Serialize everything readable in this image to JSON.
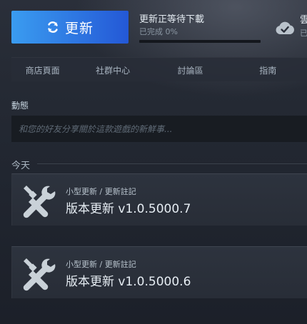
{
  "top": {
    "update_button_label": "更新",
    "download_status_title": "更新正等待下載",
    "download_status_sub": "已完成 0%",
    "download_progress_percent": 0,
    "cloud_label": "雲",
    "cloud_sub": "已",
    "update_button_color": "#2f7ee6"
  },
  "tabs": [
    {
      "label": "商店頁面"
    },
    {
      "label": "社群中心"
    },
    {
      "label": "討論區"
    },
    {
      "label": "指南"
    }
  ],
  "activity": {
    "heading": "動態",
    "placeholder": "和您的好友分享關於這款遊戲的新鮮事..."
  },
  "today": {
    "label": "今天"
  },
  "updates": [
    {
      "kind": "小型更新 / 更新註記",
      "title": "版本更新 v1.0.5000.7",
      "icon": "tools-icon"
    },
    {
      "kind": "小型更新 / 更新註記",
      "title": "版本更新 v1.0.5000.6",
      "icon": "tools-icon"
    }
  ]
}
